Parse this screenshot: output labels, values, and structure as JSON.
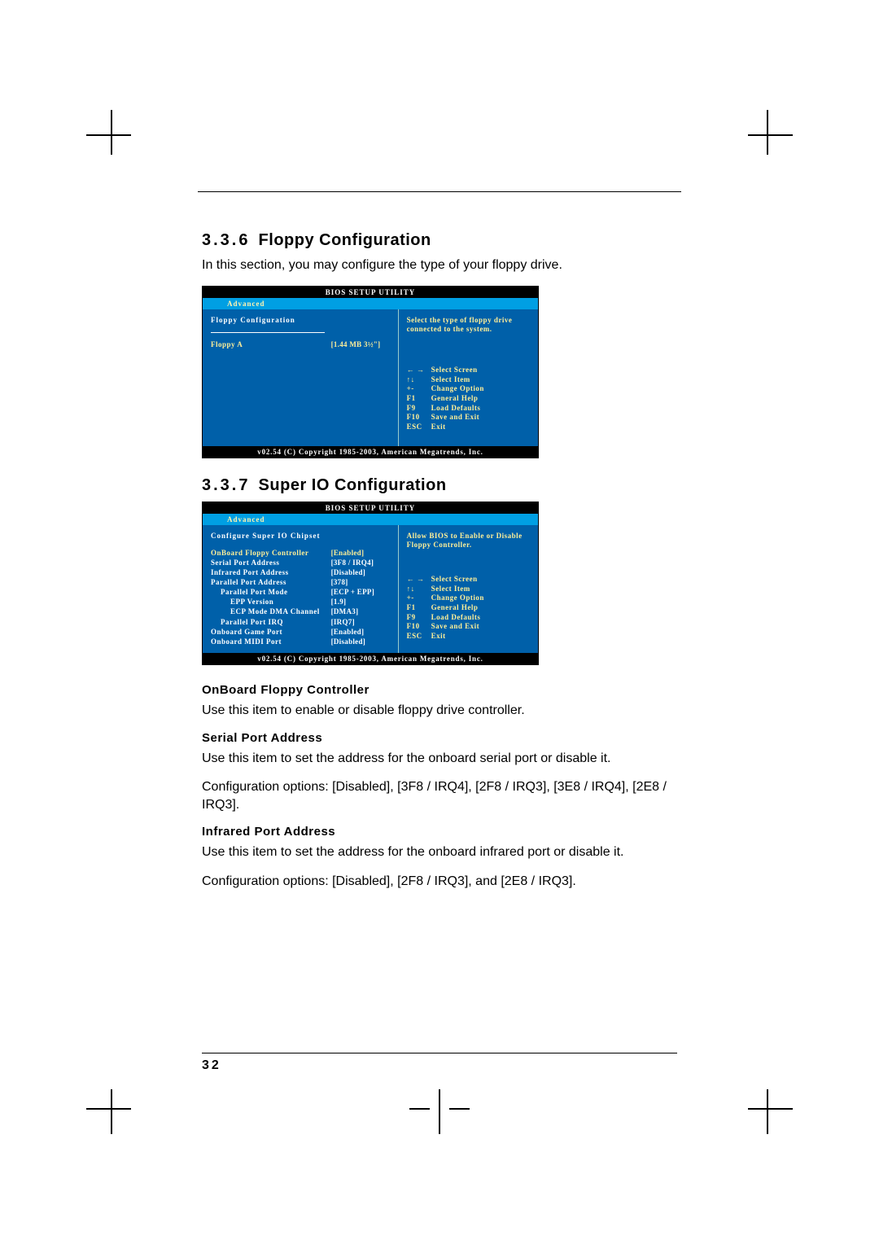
{
  "section1": {
    "number": "3.3.6",
    "title": "Floppy Configuration",
    "intro": "In this section, you may configure the type of your floppy drive."
  },
  "section2": {
    "number": "3.3.7",
    "title": "Super IO Configuration"
  },
  "bios_common": {
    "header": "BIOS SETUP UTILITY",
    "tab": "Advanced",
    "footer": "v02.54 (C) Copyright 1985-2003, American Megatrends, Inc.",
    "keys": {
      "arrows_lr": "← →",
      "arrows_ud": "↑↓",
      "pm": "+-",
      "f1": "F1",
      "f9": "F9",
      "f10": "F10",
      "esc": "ESC",
      "select_screen": "Select Screen",
      "select_item": "Select Item",
      "change_option": "Change Option",
      "general_help": "General Help",
      "load_defaults": "Load Defaults",
      "save_exit": "Save and Exit",
      "exit": "Exit"
    }
  },
  "bios1": {
    "panel_title": "Floppy Configuration",
    "help": "Select the type of floppy drive connected to the system.",
    "row": {
      "label": "Floppy A",
      "value": "[1.44 MB 3½\"]"
    }
  },
  "bios2": {
    "panel_title": "Configure Super IO Chipset",
    "help": "Allow BIOS to Enable or Disable Floppy Controller.",
    "rows": {
      "r1": {
        "label": "OnBoard Floppy Controller",
        "value": "[Enabled]"
      },
      "r2": {
        "label": "Serial Port Address",
        "value": "[3F8 / IRQ4]"
      },
      "r3": {
        "label": "Infrared Port Address",
        "value": "[Disabled]"
      },
      "r4": {
        "label": "Parallel Port Address",
        "value": "[378]"
      },
      "r5": {
        "label": "Parallel Port Mode",
        "value": "[ECP + EPP]"
      },
      "r6": {
        "label": "EPP Version",
        "value": "[1.9]"
      },
      "r7": {
        "label": "ECP Mode DMA Channel",
        "value": "[DMA3]"
      },
      "r8": {
        "label": "Parallel Port IRQ",
        "value": "[IRQ7]"
      },
      "r9": {
        "label": "Onboard Game Port",
        "value": "[Enabled]"
      },
      "r10": {
        "label": "Onboard MIDI Port",
        "value": "[Disabled]"
      }
    }
  },
  "items": {
    "i1": {
      "title": "OnBoard Floppy Controller",
      "body": "Use this item to enable or disable floppy drive controller."
    },
    "i2": {
      "title": "Serial Port Address",
      "body1": "Use this item to set the address for the onboard serial port or disable it.",
      "body2": "Configuration options: [Disabled], [3F8 / IRQ4], [2F8 / IRQ3], [3E8 / IRQ4], [2E8 / IRQ3]."
    },
    "i3": {
      "title": "Infrared Port Address",
      "body1": "Use this item to set the address for the onboard infrared port or disable it.",
      "body2": "Configuration options: [Disabled], [2F8 / IRQ3], and [2E8 / IRQ3]."
    }
  },
  "page_number": "32"
}
